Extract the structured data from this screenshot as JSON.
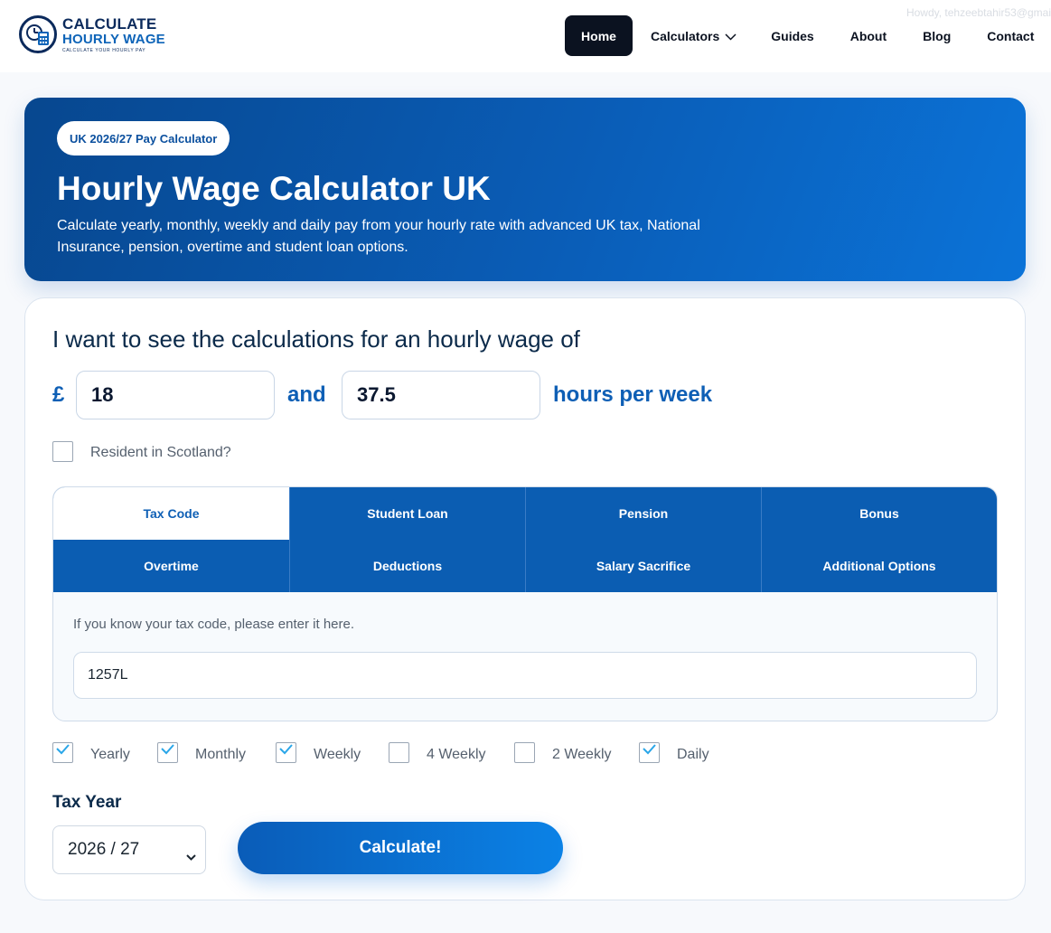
{
  "header": {
    "howdy_text": "Howdy, tehzeebtahir53@gmai",
    "logo": {
      "line1": "CALCULATE",
      "line2": "HOURLY WAGE",
      "tagline": "CALCULATE YOUR HOURLY PAY"
    },
    "nav": {
      "home": "Home",
      "calculators": "Calculators",
      "guides": "Guides",
      "about": "About",
      "blog": "Blog",
      "contact": "Contact"
    }
  },
  "hero": {
    "badge": "UK 2026/27 Pay Calculator",
    "title": "Hourly Wage Calculator UK",
    "description": "Calculate yearly, monthly, weekly and daily pay from your hourly rate with advanced UK tax, National Insurance, pension, overtime and student loan options."
  },
  "form": {
    "question": "I want to see the calculations for an hourly wage of",
    "currency_symbol": "£",
    "hourly_rate": "18",
    "and_text": "and",
    "hours": "37.5",
    "hours_suffix": "hours per week",
    "scotland_label": "Resident in Scotland?",
    "scotland_checked": false,
    "tabs": [
      {
        "label": "Tax Code",
        "active": true
      },
      {
        "label": "Student Loan",
        "active": false
      },
      {
        "label": "Pension",
        "active": false
      },
      {
        "label": "Bonus",
        "active": false
      },
      {
        "label": "Overtime",
        "active": false
      },
      {
        "label": "Deductions",
        "active": false
      },
      {
        "label": "Salary Sacrifice",
        "active": false
      },
      {
        "label": "Additional Options",
        "active": false
      }
    ],
    "tax_code_help": "If you know your tax code, please enter it here.",
    "tax_code_value": "1257L",
    "periods": [
      {
        "label": "Yearly",
        "checked": true
      },
      {
        "label": "Monthly",
        "checked": true
      },
      {
        "label": "Weekly",
        "checked": true
      },
      {
        "label": "4 Weekly",
        "checked": false
      },
      {
        "label": "2 Weekly",
        "checked": false
      },
      {
        "label": "Daily",
        "checked": true
      }
    ],
    "tax_year_label": "Tax Year",
    "tax_year_value": "2026 / 27",
    "calculate_label": "Calculate!"
  },
  "colors": {
    "brand_blue": "#0b5db2",
    "nav_active": "#0b1220",
    "accent_text": "#0e5fb5"
  }
}
